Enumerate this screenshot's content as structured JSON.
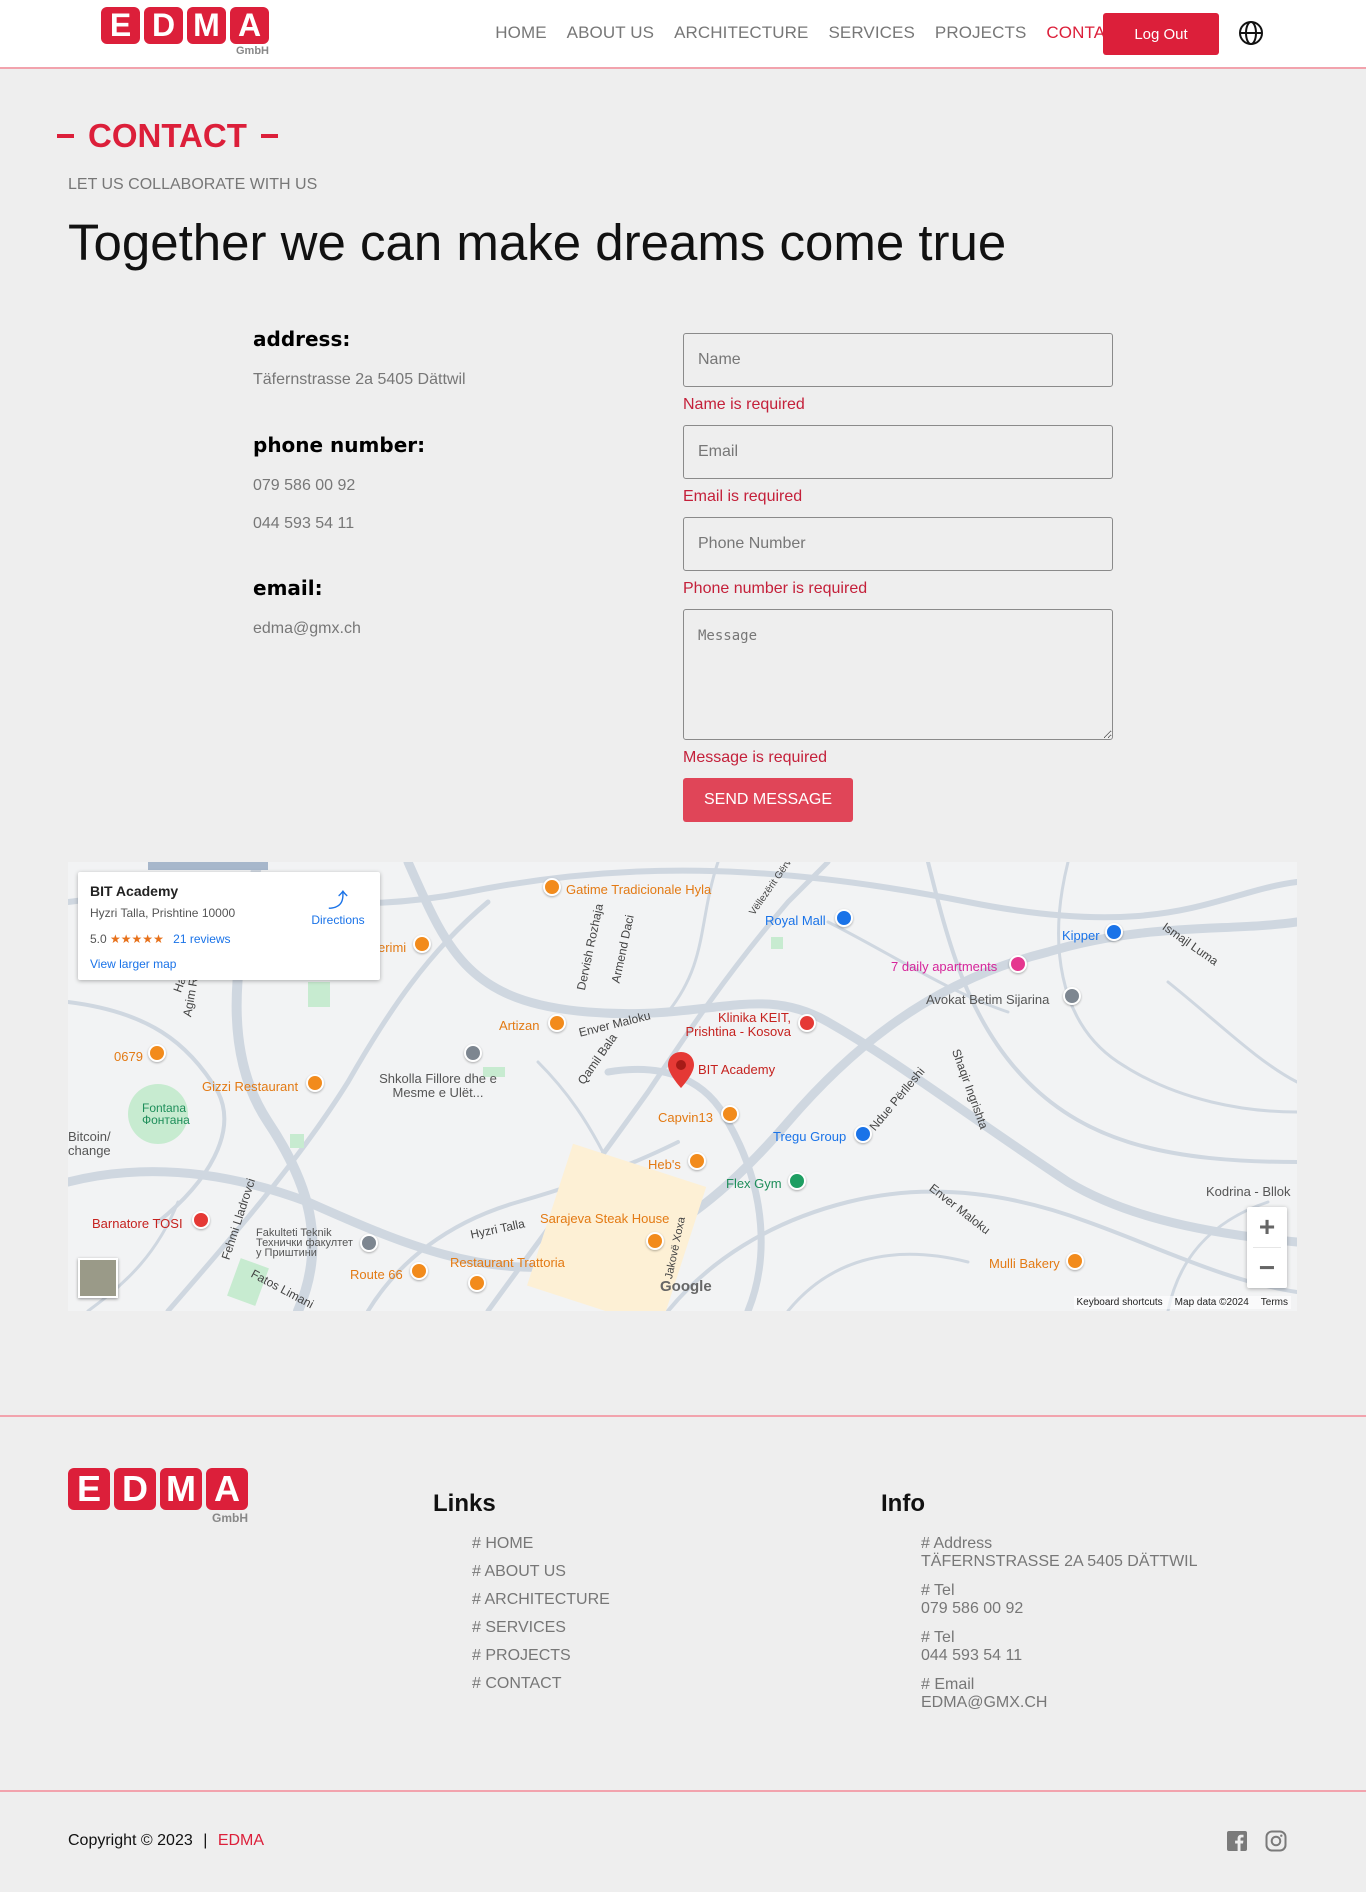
{
  "brand": {
    "letters": [
      "E",
      "D",
      "M",
      "A"
    ],
    "suffix": "GmbH",
    "color": "#dc1f3a"
  },
  "nav": {
    "items": [
      "HOME",
      "ABOUT US",
      "ARCHITECTURE",
      "SERVICES",
      "PROJECTS",
      "CONTACT"
    ],
    "active": "CONTACT",
    "logout_label": "Log Out",
    "language_icon": "globe-icon"
  },
  "contact": {
    "section_title": "CONTACT",
    "subtitle": "LET US COLLABORATE WITH US",
    "headline": "Together we can make dreams come true",
    "address_label": "address:",
    "address_value": "Täfernstrasse 2a 5405 Dättwil",
    "phone_label": "phone number:",
    "phone_1": "079 586 00 92",
    "phone_2": "044 593 54 11",
    "email_label": "email:",
    "email_value": "edma@gmx.ch"
  },
  "form": {
    "name_placeholder": "Name",
    "name_error": "Name is required",
    "email_placeholder": "Email",
    "email_error": "Email is required",
    "phone_placeholder": "Phone Number",
    "phone_error": "Phone number is required",
    "message_placeholder": "Message",
    "message_error": "Message is required",
    "submit_label": "SEND MESSAGE"
  },
  "map": {
    "place_name": "BIT Academy",
    "place_address": "Hyzri Talla, Prishtine 10000",
    "rating": "5.0",
    "stars": "★★★★★",
    "reviews": "21 reviews",
    "directions_label": "Directions",
    "larger_map_label": "View larger map",
    "zoom_in": "+",
    "zoom_out": "−",
    "google_label": "Google",
    "attribution": [
      "Keyboard shortcuts",
      "Map data ©2024",
      "Terms"
    ],
    "pois": [
      {
        "label": "Gatime Tradicionale Hyla",
        "kind": "orange"
      },
      {
        "label": "Royal Mall",
        "kind": "blue"
      },
      {
        "label": "Kipper",
        "kind": "blue"
      },
      {
        "label": "7 daily apartments",
        "kind": "pink"
      },
      {
        "label": "Avokat Betim Sijarina",
        "kind": "gray"
      },
      {
        "label": "Klinika KEIT, Prishtina - Kosova",
        "kind": "red"
      },
      {
        "label": "BIT Academy",
        "kind": "red"
      },
      {
        "label": "Artizan",
        "kind": "orange"
      },
      {
        "label": "0679",
        "kind": "orange"
      },
      {
        "label": "Gizzi Restaurant",
        "kind": "orange"
      },
      {
        "label": "Shkolla Fillore dhe e Mesme e Ulët...",
        "kind": "gray"
      },
      {
        "label": "Fontana Фонтана",
        "kind": "green"
      },
      {
        "label": "Capvin13",
        "kind": "orange"
      },
      {
        "label": "Tregu Group",
        "kind": "blue"
      },
      {
        "label": "Heb's",
        "kind": "orange"
      },
      {
        "label": "Flex Gym",
        "kind": "green"
      },
      {
        "label": "Sarajeva Steak House",
        "kind": "orange"
      },
      {
        "label": "Barnatore TOSI",
        "kind": "red"
      },
      {
        "label": "Fakulteti Teknik Технички факултет у Приштини",
        "kind": "gray"
      },
      {
        "label": "Route 66",
        "kind": "orange"
      },
      {
        "label": "Restaurant Trattoria",
        "kind": "orange"
      },
      {
        "label": "Mulli Bakery",
        "kind": "orange"
      },
      {
        "label": "Kodrina - Bllok",
        "kind": "gray"
      },
      {
        "label": "Bitcoin/ change",
        "kind": "gray"
      },
      {
        "label": "erimi",
        "kind": "orange"
      }
    ],
    "streets": [
      "Enver Maloku",
      "Hyzri Talla",
      "Ndue Përlleshi",
      "Fehmi Lladrovci",
      "Fatos Limani",
      "Agim Ra",
      "Dervish Rozhaja",
      "Armend Daci",
      "Qamil Bala",
      "Shaqir Ingrishta",
      "Ismajl Luma",
      "Vëllezërit Gërv",
      "Jakovë Xoxa",
      "Hakif",
      "Enver Maloku"
    ]
  },
  "footer": {
    "links_heading": "Links",
    "links": [
      "# HOME",
      "# ABOUT US",
      "# ARCHITECTURE",
      "# SERVICES",
      "# PROJECTS",
      "# CONTACT"
    ],
    "info_heading": "Info",
    "info": [
      {
        "label": "# Address",
        "value": "TÄFERNSTRASSE 2A 5405 DÄTTWIL"
      },
      {
        "label": "# Tel",
        "value": "079 586 00 92"
      },
      {
        "label": "# Tel",
        "value": "044 593 54 11"
      },
      {
        "label": "# Email",
        "value": "EDMA@GMX.CH"
      }
    ],
    "copyright": "Copyright © 2023",
    "separator": "|",
    "copyright_brand": "EDMA",
    "social_icons": [
      "facebook-icon",
      "instagram-icon"
    ]
  }
}
